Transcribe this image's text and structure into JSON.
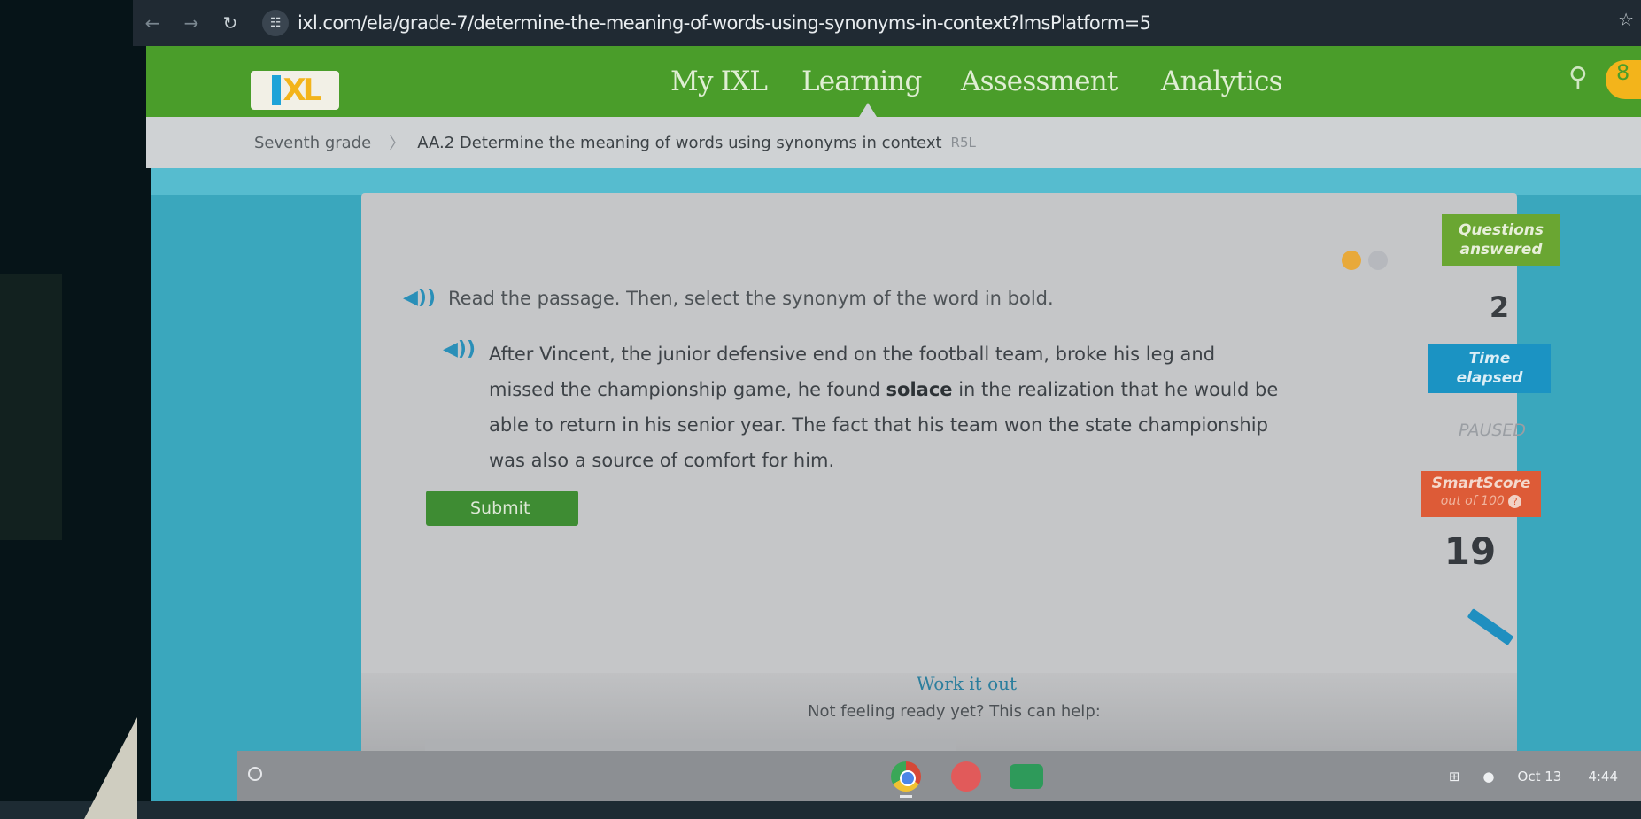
{
  "browser": {
    "back_icon": "arrow-left-icon",
    "forward_icon": "arrow-right-icon",
    "reload_icon": "reload-icon",
    "site_info_icon": "tune-icon",
    "url": "ixl.com/ela/grade-7/determine-the-meaning-of-words-using-synonyms-in-context?lmsPlatform=5",
    "bookmark_icon": "star-icon"
  },
  "header": {
    "logo_text": "XL",
    "nav": [
      "My IXL",
      "Learning",
      "Assessment",
      "Analytics"
    ],
    "active_nav": "Learning",
    "search_icon": "search-icon",
    "user_initial": "8"
  },
  "breadcrumb": {
    "grade": "Seventh grade",
    "separator": "〉",
    "skill": "AA.2 Determine the meaning of words using synonyms in context",
    "code": "R5L"
  },
  "question": {
    "progress": {
      "answered_dots": 1,
      "total_dots": 2
    },
    "prompt": "Read the passage. Then, select the synonym of the word in bold.",
    "passage_before": "After Vincent, the junior defensive end on the football team, broke his leg and missed the championship game, he found ",
    "passage_bold": "solace",
    "passage_after": " in the realization that he would be able to return in his senior year. The fact that his team won the state championship was also a source of comfort for him.",
    "submit_label": "Submit"
  },
  "stats": {
    "questions_label_1": "Questions",
    "questions_label_2": "answered",
    "questions_value": "2",
    "time_label_1": "Time",
    "time_label_2": "elapsed",
    "time_value": "PAUSED",
    "smartscore_label": "SmartScore",
    "smartscore_sub": "out of 100",
    "smartscore_help": "?",
    "smartscore_value": "19",
    "colors": {
      "questions": "#6aa632",
      "time": "#1b93c3",
      "smartscore": "#dd5b37"
    }
  },
  "work_it_out": {
    "title": "Work it out",
    "subtitle": "Not feeling ready yet? This can help:"
  },
  "taskbar": {
    "apps": [
      "chrome-icon",
      "photos-icon",
      "classroom-icon"
    ],
    "tray_icons": [
      "screen-capture-icon",
      "record-icon"
    ],
    "date": "Oct 13",
    "time": "4:44"
  }
}
